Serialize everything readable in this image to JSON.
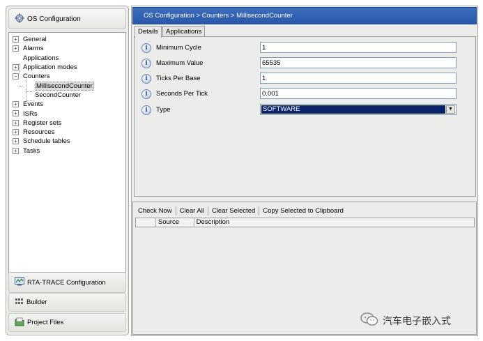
{
  "left": {
    "header_label": "OS Configuration",
    "tree": [
      {
        "label": "General",
        "expander": "+"
      },
      {
        "label": "Alarms",
        "expander": "+"
      },
      {
        "label": "Applications",
        "expander": ""
      },
      {
        "label": "Application modes",
        "expander": "+"
      },
      {
        "label": "Counters",
        "expander": "−"
      },
      {
        "label": "MillisecondCounter",
        "expander": ""
      },
      {
        "label": "SecondCounter",
        "expander": ""
      },
      {
        "label": "Events",
        "expander": "+"
      },
      {
        "label": "ISRs",
        "expander": "+"
      },
      {
        "label": "Register sets",
        "expander": "+"
      },
      {
        "label": "Resources",
        "expander": "+"
      },
      {
        "label": "Schedule tables",
        "expander": "+"
      },
      {
        "label": "Tasks",
        "expander": "+"
      }
    ],
    "nav": {
      "rta_trace": "RTA-TRACE Configuration",
      "builder": "Builder",
      "project_files": "Project Files"
    }
  },
  "right": {
    "breadcrumb": "OS Configuration  >  Counters  >  MillisecondCounter",
    "tabs": [
      "Details",
      "Applications"
    ],
    "properties": [
      {
        "label": "Minimum Cycle",
        "value": "1"
      },
      {
        "label": "Maximum Value",
        "value": "65535"
      },
      {
        "label": "Ticks Per Base",
        "value": "1"
      },
      {
        "label": "Seconds Per Tick",
        "value": "0.001"
      }
    ],
    "type_label": "Type",
    "type_value": "SOFTWARE",
    "toolbar": {
      "check_now": "Check Now",
      "clear_all": "Clear All",
      "clear_selected": "Clear Selected",
      "copy_selected": "Copy Selected to Clipboard"
    },
    "grid_headers": {
      "source": "Source",
      "description": "Description"
    }
  },
  "watermark": "汽车电子嵌入式",
  "colors": {
    "title_bar": "#2f60b0",
    "selection": "#0a246a"
  }
}
